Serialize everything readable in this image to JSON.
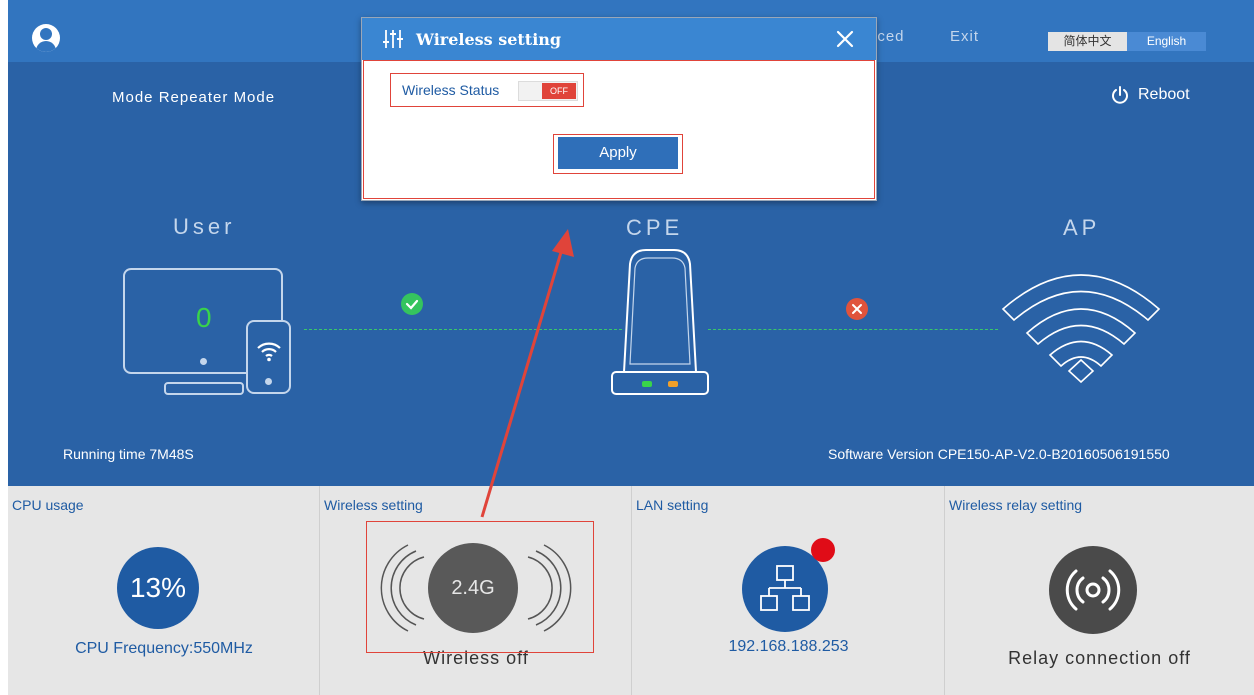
{
  "nav": {
    "advanced_partial": "nced",
    "exit": "Exit",
    "lang_cn": "简体中文",
    "lang_en": "English"
  },
  "header": {
    "mode": "Mode  Repeater Mode",
    "reboot": "Reboot"
  },
  "topology": {
    "user_label": "User",
    "cpe_label": "CPE",
    "ap_label": "AP",
    "user_count": "0"
  },
  "footer_info": {
    "running_time": "Running time  7M48S",
    "software_version": "Software Version  CPE150-AP-V2.0-B20160506191550"
  },
  "panels": {
    "cpu": {
      "title": "CPU usage",
      "value": "13%",
      "frequency": "CPU Frequency:550MHz"
    },
    "wireless": {
      "title": "Wireless setting",
      "band": "2.4G",
      "status": "Wireless off"
    },
    "lan": {
      "title": "LAN setting",
      "ip": "192.168.188.253"
    },
    "relay": {
      "title": "Wireless relay setting",
      "status": "Relay connection off"
    }
  },
  "modal": {
    "title": "Wireless setting",
    "wireless_status_label": "Wireless Status",
    "toggle_state": "OFF",
    "apply": "Apply"
  },
  "colors": {
    "primary_blue": "#2a62a6",
    "header_blue": "#3275bf",
    "modal_header": "#3a86d2",
    "status_ok": "#35c45e",
    "status_error": "#e0533c",
    "highlight_red": "#e0443a"
  },
  "icons": {
    "avatar": "user-avatar-icon",
    "reboot": "power-icon",
    "modal": "sliders-icon",
    "close": "close-icon",
    "lan": "network-topology-icon",
    "relay": "broadcast-icon"
  }
}
